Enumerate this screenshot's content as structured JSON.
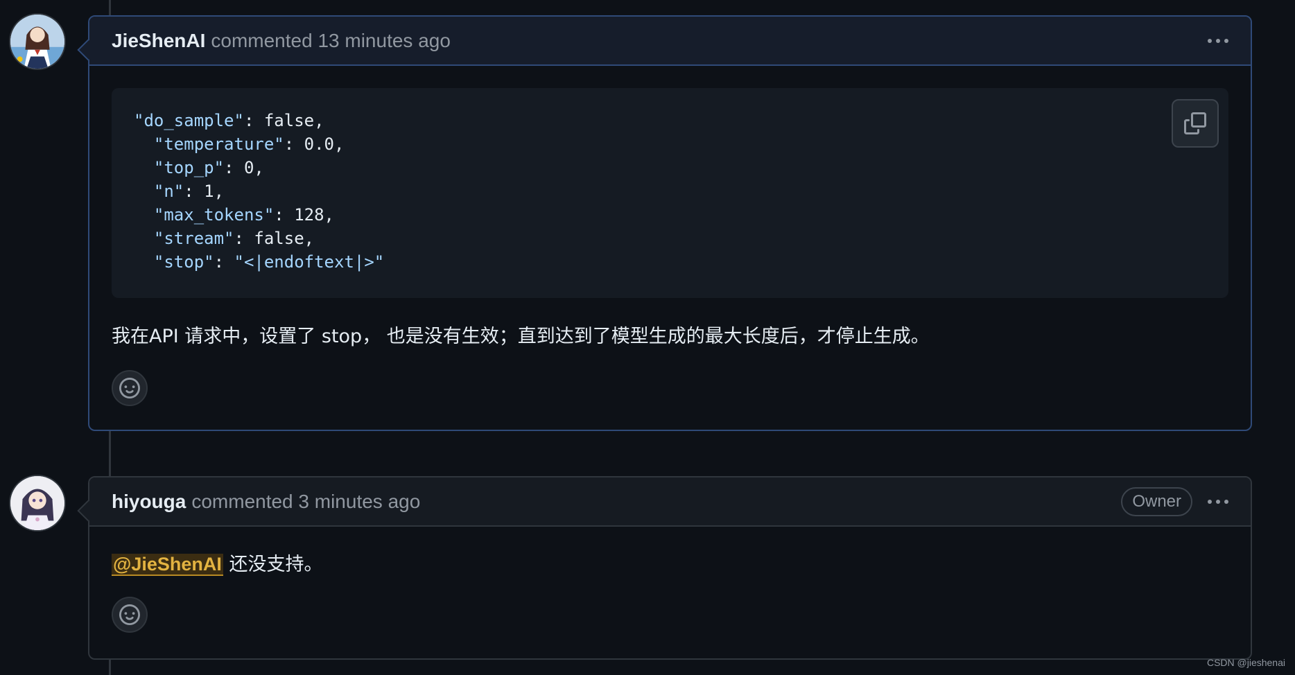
{
  "comments": [
    {
      "author": "JieShenAI",
      "meta": "commented 13 minutes ago",
      "avatar": "anime-girl-avatar",
      "code_lines": [
        [
          {
            "t": "\"do_sample\"",
            "c": "str"
          },
          {
            "t": ": false,",
            "c": ""
          }
        ],
        [
          {
            "t": "  \"temperature\"",
            "c": "str"
          },
          {
            "t": ": 0.0,",
            "c": ""
          }
        ],
        [
          {
            "t": "  \"top_p\"",
            "c": "str"
          },
          {
            "t": ": 0,",
            "c": ""
          }
        ],
        [
          {
            "t": "  \"n\"",
            "c": "str"
          },
          {
            "t": ": 1,",
            "c": ""
          }
        ],
        [
          {
            "t": "  \"max_tokens\"",
            "c": "str"
          },
          {
            "t": ": 128,",
            "c": ""
          }
        ],
        [
          {
            "t": "  \"stream\"",
            "c": "str"
          },
          {
            "t": ": false,",
            "c": ""
          }
        ],
        [
          {
            "t": "  \"stop\"",
            "c": "str"
          },
          {
            "t": ": ",
            "c": ""
          },
          {
            "t": "\"<|endoftext|>\"",
            "c": "str"
          }
        ]
      ],
      "body": "我在API 请求中，设置了 stop， 也是没有生效；直到达到了模型生成的最大长度后，才停止生成。"
    },
    {
      "author": "hiyouga",
      "meta": "commented 3 minutes ago",
      "badge": "Owner",
      "avatar": "anime-girl-avatar",
      "mention": "@JieShenAI",
      "body": " 还没支持。"
    }
  ],
  "icons": {
    "copy": "copy-icon",
    "smiley": "smiley-icon",
    "kebab": "kebab-horizontal-icon"
  },
  "colors": {
    "background": "#0d1117",
    "accent_border": "#2f4a78",
    "string": "#a5d6ff",
    "mention": "#e3b341"
  },
  "watermark": "CSDN @jieshenai"
}
